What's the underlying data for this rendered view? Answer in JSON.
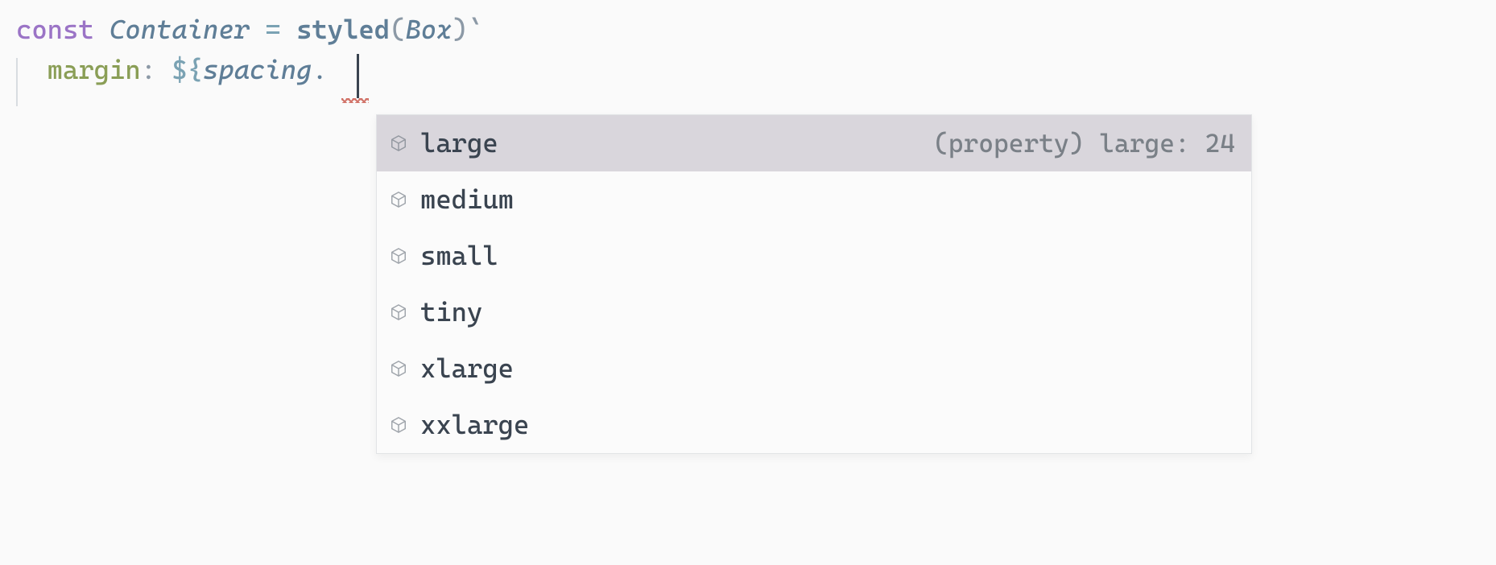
{
  "code": {
    "line1": {
      "keyword": "const",
      "typename": "Container",
      "equals": "=",
      "func": "styled",
      "lparen": "(",
      "arg": "Box",
      "rparen": ")",
      "backtick": "`"
    },
    "line2": {
      "cssprop": "margin",
      "colon": ":",
      "interp_open": "${",
      "ident": "spacing",
      "dot": "."
    }
  },
  "suggestions": {
    "items": [
      {
        "label": "large",
        "detail": "(property) large: 24",
        "selected": true
      },
      {
        "label": "medium",
        "detail": "",
        "selected": false
      },
      {
        "label": "small",
        "detail": "",
        "selected": false
      },
      {
        "label": "tiny",
        "detail": "",
        "selected": false
      },
      {
        "label": "xlarge",
        "detail": "",
        "selected": false
      },
      {
        "label": "xxlarge",
        "detail": "",
        "selected": false
      }
    ]
  }
}
